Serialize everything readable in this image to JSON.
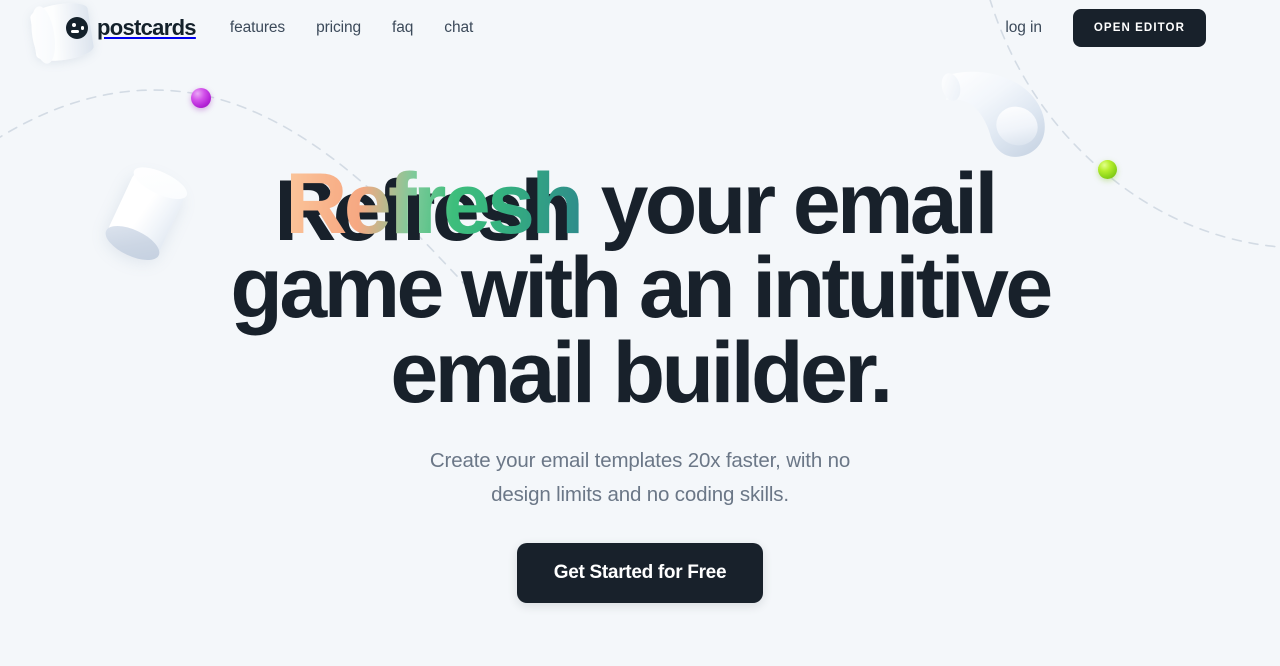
{
  "brand": {
    "name": "postcards",
    "mark_icon": "smiley-face-circle-icon"
  },
  "nav": {
    "items": [
      {
        "label": "features"
      },
      {
        "label": "pricing"
      },
      {
        "label": "faq"
      },
      {
        "label": "chat"
      }
    ],
    "login_label": "log in",
    "editor_button_label": "OPEN EDITOR"
  },
  "hero": {
    "headline": {
      "accent_word": "Refresh",
      "line1_rest": " your email",
      "line2": "game with an intuitive",
      "line3": "email builder."
    },
    "subhead_line1": "Create your email templates 20x faster, with no",
    "subhead_line2": "design limits and no coding skills.",
    "cta_label": "Get Started for Free"
  },
  "decor": {
    "cylinder_logo": "white-cylinder-shape",
    "cylinder_left": "white-cylinder-shape",
    "tube_right": "bent-tube-shape",
    "sphere_purple": "purple-sphere-shape",
    "sphere_green": "green-sphere-shape",
    "dashed_path_left": "dashed-arc-path",
    "dashed_path_right": "dashed-descending-path"
  },
  "colors": {
    "background": "#f4f7fa",
    "ink": "#18212b",
    "muted_text": "#6b7787",
    "accent_start": "#f9b48a",
    "accent_mid": "#3dbe7c",
    "accent_end": "#2e8b8b",
    "sphere_purple": "#c233e0",
    "sphere_green": "#9ade1e"
  }
}
